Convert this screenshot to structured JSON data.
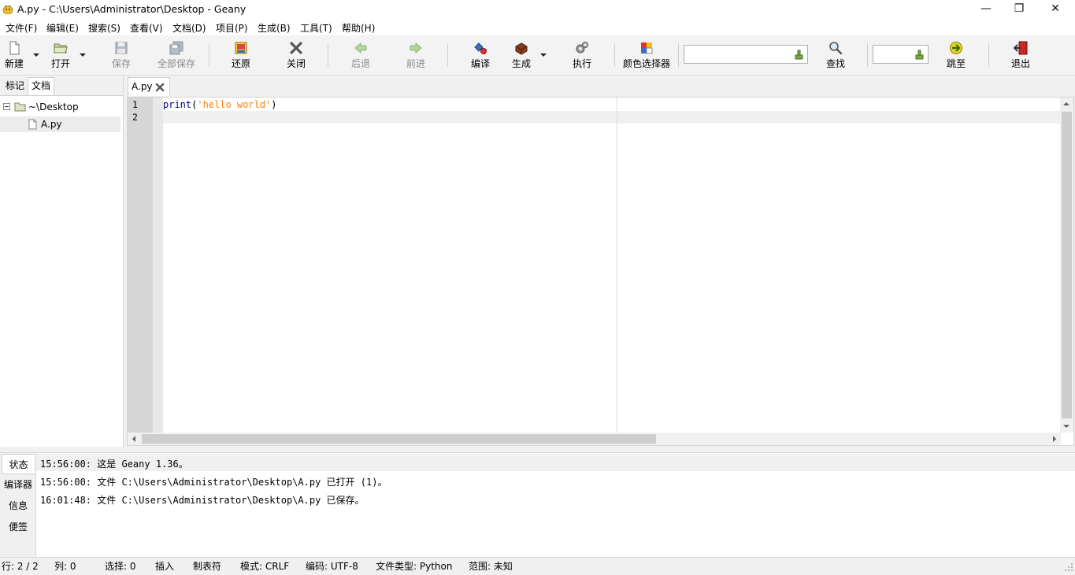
{
  "window": {
    "title": "A.py - C:\\Users\\Administrator\\Desktop - Geany",
    "minimize_glyph": "—",
    "restore_glyph": "❐",
    "close_glyph": "✕"
  },
  "menu": [
    "文件(F)",
    "编辑(E)",
    "搜索(S)",
    "查看(V)",
    "文档(D)",
    "项目(P)",
    "生成(B)",
    "工具(T)",
    "帮助(H)"
  ],
  "toolbar": {
    "new": "新建",
    "open": "打开",
    "save": "保存",
    "save_all": "全部保存",
    "revert": "还原",
    "close": "关闭",
    "back": "后退",
    "forward": "前进",
    "compile": "编译",
    "build": "生成",
    "execute": "执行",
    "color_picker": "颜色选择器",
    "search_value": "",
    "find": "查找",
    "goto_value": "",
    "goto": "跳至",
    "quit": "退出"
  },
  "sidebar": {
    "tabs": [
      "标记",
      "文档"
    ],
    "active_tab": "文档",
    "folder": "~\\Desktop",
    "file": "A.py"
  },
  "editor": {
    "tab_name": "A.py",
    "line_numbers": [
      "1",
      "2"
    ],
    "code": {
      "keyword": "print",
      "open_paren": "(",
      "string": "'hello world'",
      "close_paren": ")"
    }
  },
  "messages": {
    "tabs": [
      "状态",
      "编译器",
      "信息",
      "便签"
    ],
    "active_tab": "状态",
    "lines": [
      "15:56:00: 这是 Geany 1.36。",
      "15:56:00: 文件 C:\\Users\\Administrator\\Desktop\\A.py 已打开 (1)。",
      "16:01:48: 文件 C:\\Users\\Administrator\\Desktop\\A.py 已保存。"
    ]
  },
  "status": {
    "line": "行: 2 / 2",
    "col": "列: 0",
    "sel": "选择: 0",
    "mode_ins": "插入",
    "indent": "制表符",
    "eol": "模式: CRLF",
    "encoding": "编码: UTF-8",
    "filetype": "文件类型: Python",
    "scope": "范围: 未知"
  }
}
